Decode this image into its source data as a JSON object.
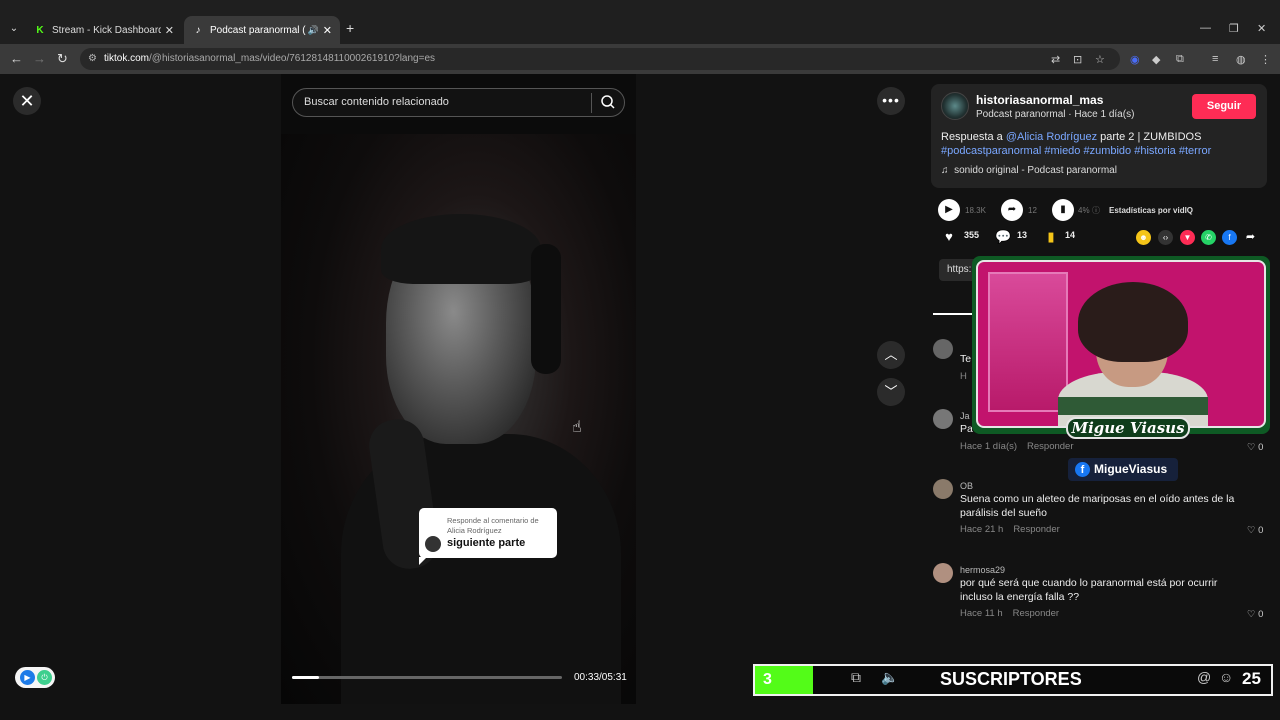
{
  "browser": {
    "tabs": [
      {
        "label": "Stream - Kick Dashboard",
        "favicon": "kick-icon",
        "active": false
      },
      {
        "label": "Podcast paranormal (@hist",
        "favicon": "tiktok-icon",
        "active": true
      }
    ],
    "address": {
      "domain": "tiktok.com",
      "path": "/@historiasanormal_mas/video/7612814811000261910?lang=es"
    }
  },
  "video": {
    "search_placeholder": "Buscar contenido relacionado",
    "reply_card": {
      "line1": "Responde al comentario de",
      "line2": "Alicia Rodríguez",
      "text": "siguiente parte"
    },
    "time": "00:33/05:31",
    "progress": 0.1
  },
  "author": {
    "username": "historiasanormal_mas",
    "subtitle": "Podcast paranormal · Hace 1 día(s)",
    "follow_label": "Seguir"
  },
  "description": {
    "prefix": "Respuesta a ",
    "mention": "@Alicia Rodríguez",
    "suffix": " parte 2 | ZUMBIDOS",
    "hashtags": "#podcastparanormal #miedo #zumbido #historia #terror",
    "sound": "sonido original - Podcast paranormal"
  },
  "stats": {
    "plays": "18.3K",
    "shares": "12",
    "pct": "4%",
    "vidiq_label": "Estadísticas por vidIQ",
    "likes": "355",
    "comments": "13",
    "saves": "14",
    "url_fragment": "https:"
  },
  "comments": [
    {
      "name": "",
      "text": "Te",
      "time": "H",
      "reply": "",
      "likes": ""
    },
    {
      "name": "Ja",
      "text": "Pa",
      "time": "Hace 1 día(s)",
      "reply": "Responder",
      "likes": "0"
    },
    {
      "name": "OB",
      "text": "Suena como un aleteo de mariposas en el oído antes de la parálisis del sueño",
      "time": "Hace 21 h",
      "reply": "Responder",
      "likes": "0"
    },
    {
      "name": "hermosa29",
      "text": "por qué será que cuando lo paranormal está por ocurrir incluso la energía falla ??",
      "time": "Hace 11 h",
      "reply": "Responder",
      "likes": "0"
    }
  ],
  "overlay": {
    "streamer_name": "Migue Viasus",
    "facebook_handle": "MigueViasus",
    "sub_count": "3",
    "sub_label": "SUSCRIPTORES",
    "sub_goal": "25"
  },
  "colors": {
    "follow": "#fe2c55",
    "kick_green": "#53fc18",
    "link": "#7aa7ff"
  }
}
